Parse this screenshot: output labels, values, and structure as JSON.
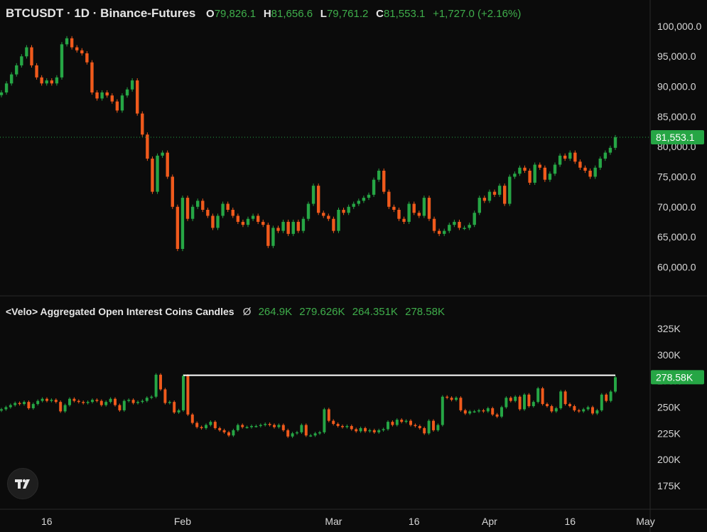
{
  "price_header": {
    "title": "BTCUSDT · 1D · Binance-Futures",
    "open_label": "O",
    "open": "79,826.1",
    "high_label": "H",
    "high": "81,656.6",
    "low_label": "L",
    "low": "79,761.2",
    "close_label": "C",
    "close": "81,553.1",
    "change": "+1,727.0 (+2.16%)"
  },
  "oi_header": {
    "title": "<Velo> Aggregated Open Interest Coins Candles",
    "empty_symbol": "Ø",
    "values": [
      "264.9K",
      "279.626K",
      "264.351K",
      "278.58K"
    ]
  },
  "colors": {
    "up": "#26a645",
    "down": "#f05a1c",
    "background": "#0b0b0b",
    "grid": "#1a1a1a",
    "last_price": "#26a645"
  },
  "chart_data": [
    {
      "type": "candlestick",
      "title": "BTCUSDT · 1D · Binance-Futures",
      "ylim": [
        56500,
        102000
      ],
      "y_ticks": [
        60000,
        65000,
        70000,
        75000,
        80000,
        85000,
        90000,
        95000,
        100000
      ],
      "y_tick_labels": [
        "60,000.0",
        "65,000.0",
        "70,000.0",
        "75,000.0",
        "80,000.0",
        "85,000.0",
        "90,000.0",
        "95,000.0",
        "100,000.0"
      ],
      "last_value": 81553.1,
      "last_value_label": "81,553.1",
      "grid": false,
      "close": [
        89000,
        90500,
        92000,
        93500,
        95000,
        96500,
        93500,
        91500,
        90500,
        91000,
        90500,
        91500,
        97000,
        98000,
        96500,
        96000,
        95500,
        94000,
        89000,
        88000,
        89000,
        88500,
        87500,
        86000,
        88500,
        89500,
        91000,
        85500,
        82000,
        78000,
        72500,
        78500,
        79000,
        75000,
        70000,
        63000,
        71500,
        68000,
        70000,
        71000,
        69500,
        68500,
        66500,
        68500,
        70500,
        69500,
        68500,
        67500,
        67000,
        68000,
        68500,
        67500,
        67000,
        63500,
        66500,
        66000,
        67500,
        65500,
        67500,
        66000,
        68000,
        70500,
        73500,
        69000,
        68500,
        68000,
        66000,
        69500,
        69000,
        70000,
        70500,
        71000,
        71500,
        72000,
        74500,
        76000,
        72500,
        70000,
        69500,
        68000,
        67500,
        70500,
        69000,
        68500,
        71500,
        68000,
        66000,
        65500,
        66000,
        67000,
        67500,
        66500,
        66500,
        67000,
        69000,
        71500,
        71000,
        72500,
        72000,
        73500,
        70500,
        75000,
        75500,
        76500,
        76000,
        74000,
        77000,
        76500,
        74500,
        75500,
        77000,
        78500,
        78000,
        79000,
        77500,
        76500,
        76000,
        75000,
        76500,
        78000,
        79000,
        79800,
        81553
      ],
      "candles_omitted_open_high_low": "open = previous close; wicks drawn with small range"
    },
    {
      "type": "candlestick",
      "title": "<Velo> Aggregated Open Interest Coins Candles",
      "ylim": [
        160000,
        340000
      ],
      "y_ticks": [
        175000,
        200000,
        225000,
        250000,
        275000,
        300000,
        325000
      ],
      "y_tick_labels": [
        "175K",
        "200K",
        "225K",
        "250K",
        "275K",
        "300K",
        "325K"
      ],
      "last_value": 278580,
      "last_value_label": "278.58K",
      "reference_line": 280500,
      "close": [
        248000,
        250000,
        252000,
        254000,
        253000,
        255000,
        249000,
        253000,
        256000,
        258000,
        256000,
        257000,
        255000,
        246000,
        252000,
        258000,
        256000,
        255000,
        254000,
        255000,
        257000,
        256000,
        252000,
        255000,
        258000,
        252000,
        247000,
        256000,
        257000,
        254000,
        255000,
        256000,
        259000,
        260000,
        281000,
        267000,
        254000,
        255000,
        245000,
        247000,
        280000,
        243000,
        235000,
        231000,
        230000,
        233000,
        236000,
        230000,
        228000,
        226000,
        223000,
        228000,
        233000,
        231000,
        231000,
        232000,
        232000,
        233000,
        234000,
        233000,
        231000,
        233000,
        228000,
        222000,
        225000,
        226000,
        233000,
        223000,
        223000,
        225000,
        226000,
        248000,
        237000,
        234000,
        232000,
        231000,
        232000,
        229000,
        227000,
        230000,
        227000,
        228000,
        226000,
        228000,
        229000,
        236000,
        233000,
        238000,
        236000,
        237000,
        233000,
        232000,
        230000,
        225000,
        237000,
        228000,
        233000,
        260000,
        259000,
        257000,
        259000,
        247000,
        244000,
        246000,
        246000,
        247000,
        246000,
        249000,
        243000,
        241000,
        250000,
        259000,
        256000,
        260000,
        248000,
        262000,
        251000,
        255000,
        268000,
        253000,
        251000,
        246000,
        249000,
        265000,
        253000,
        251000,
        247000,
        246000,
        248000,
        250000,
        244000,
        247000,
        262000,
        256000,
        264900,
        278580
      ]
    }
  ],
  "x_axis": {
    "tick_labels": [
      "16",
      "Feb",
      "Mar",
      "16",
      "Apr",
      "16",
      "May"
    ],
    "tick_index_price": [
      9,
      36,
      66,
      82,
      97,
      113,
      128
    ]
  }
}
